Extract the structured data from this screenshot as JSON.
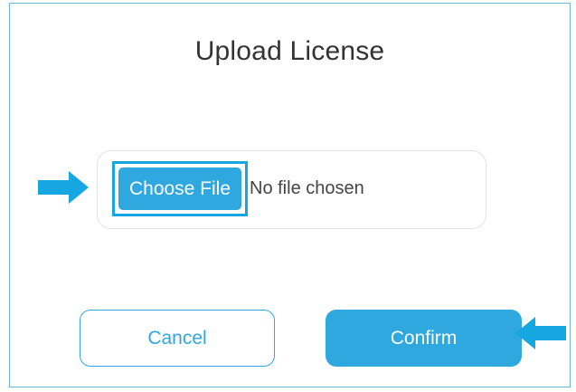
{
  "dialog": {
    "title": "Upload License"
  },
  "file_input": {
    "button_label": "Choose File",
    "status_text": "No file chosen"
  },
  "actions": {
    "cancel_label": "Cancel",
    "confirm_label": "Confirm"
  },
  "colors": {
    "accent": "#2fa7df",
    "highlight": "#16a6e0",
    "border": "#6fb6dc"
  },
  "icons": {
    "arrow_to_choose_file": "arrow-right-icon",
    "arrow_to_confirm": "arrow-left-icon"
  }
}
